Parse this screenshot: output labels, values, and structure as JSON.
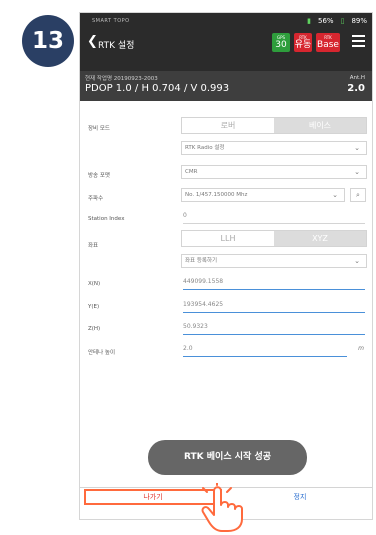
{
  "step_number": "13",
  "app": {
    "name": "SMART TOPO",
    "status": {
      "signal": "56%",
      "battery": "89%"
    },
    "title": "RTK 설정",
    "badges": [
      {
        "top": "GPS",
        "value": "30",
        "color": "#2e9d3c"
      },
      {
        "top": "RTK",
        "value": "유동",
        "color": "#d6262f"
      },
      {
        "top": "RTK",
        "value": "Base",
        "color": "#d6262f"
      }
    ]
  },
  "info": {
    "epoch": "현재 작업명 20190923-2003",
    "pdop": "PDOP 1.0 / H 0.704 / V 0.993",
    "ant_label": "Ant.H",
    "ant_value": "2.0"
  },
  "form": {
    "device_mode_label": "장비 모드",
    "device_mode_options": [
      "로버",
      "베이스"
    ],
    "radio_setting": "RTK Radio 설정",
    "format_label": "방송 포맷",
    "format_value": "CMR",
    "freq_label": "주파수",
    "freq_value": "No. 1/457.150000 Mhz",
    "station_label": "Station Index",
    "station_value": "0",
    "coord_label": "좌표",
    "coord_options": [
      "LLH",
      "XYZ"
    ],
    "coord_register": "좌표 등록하기",
    "x_label": "X(N)",
    "x_value": "449099.1558",
    "y_label": "Y(E)",
    "y_value": "193954.4625",
    "z_label": "Z(H)",
    "z_value": "50.9323",
    "ant_label": "안테나 높이",
    "ant_value": "2.0",
    "ant_unit": "m"
  },
  "toast": "RTK 베이스 시작 성공",
  "buttons": {
    "exit": "나가기",
    "stop": "정지"
  },
  "colors": {
    "accent_orange": "#ff6a3d",
    "step_navy": "#2a3f64",
    "link_blue": "#2b6fd0"
  }
}
